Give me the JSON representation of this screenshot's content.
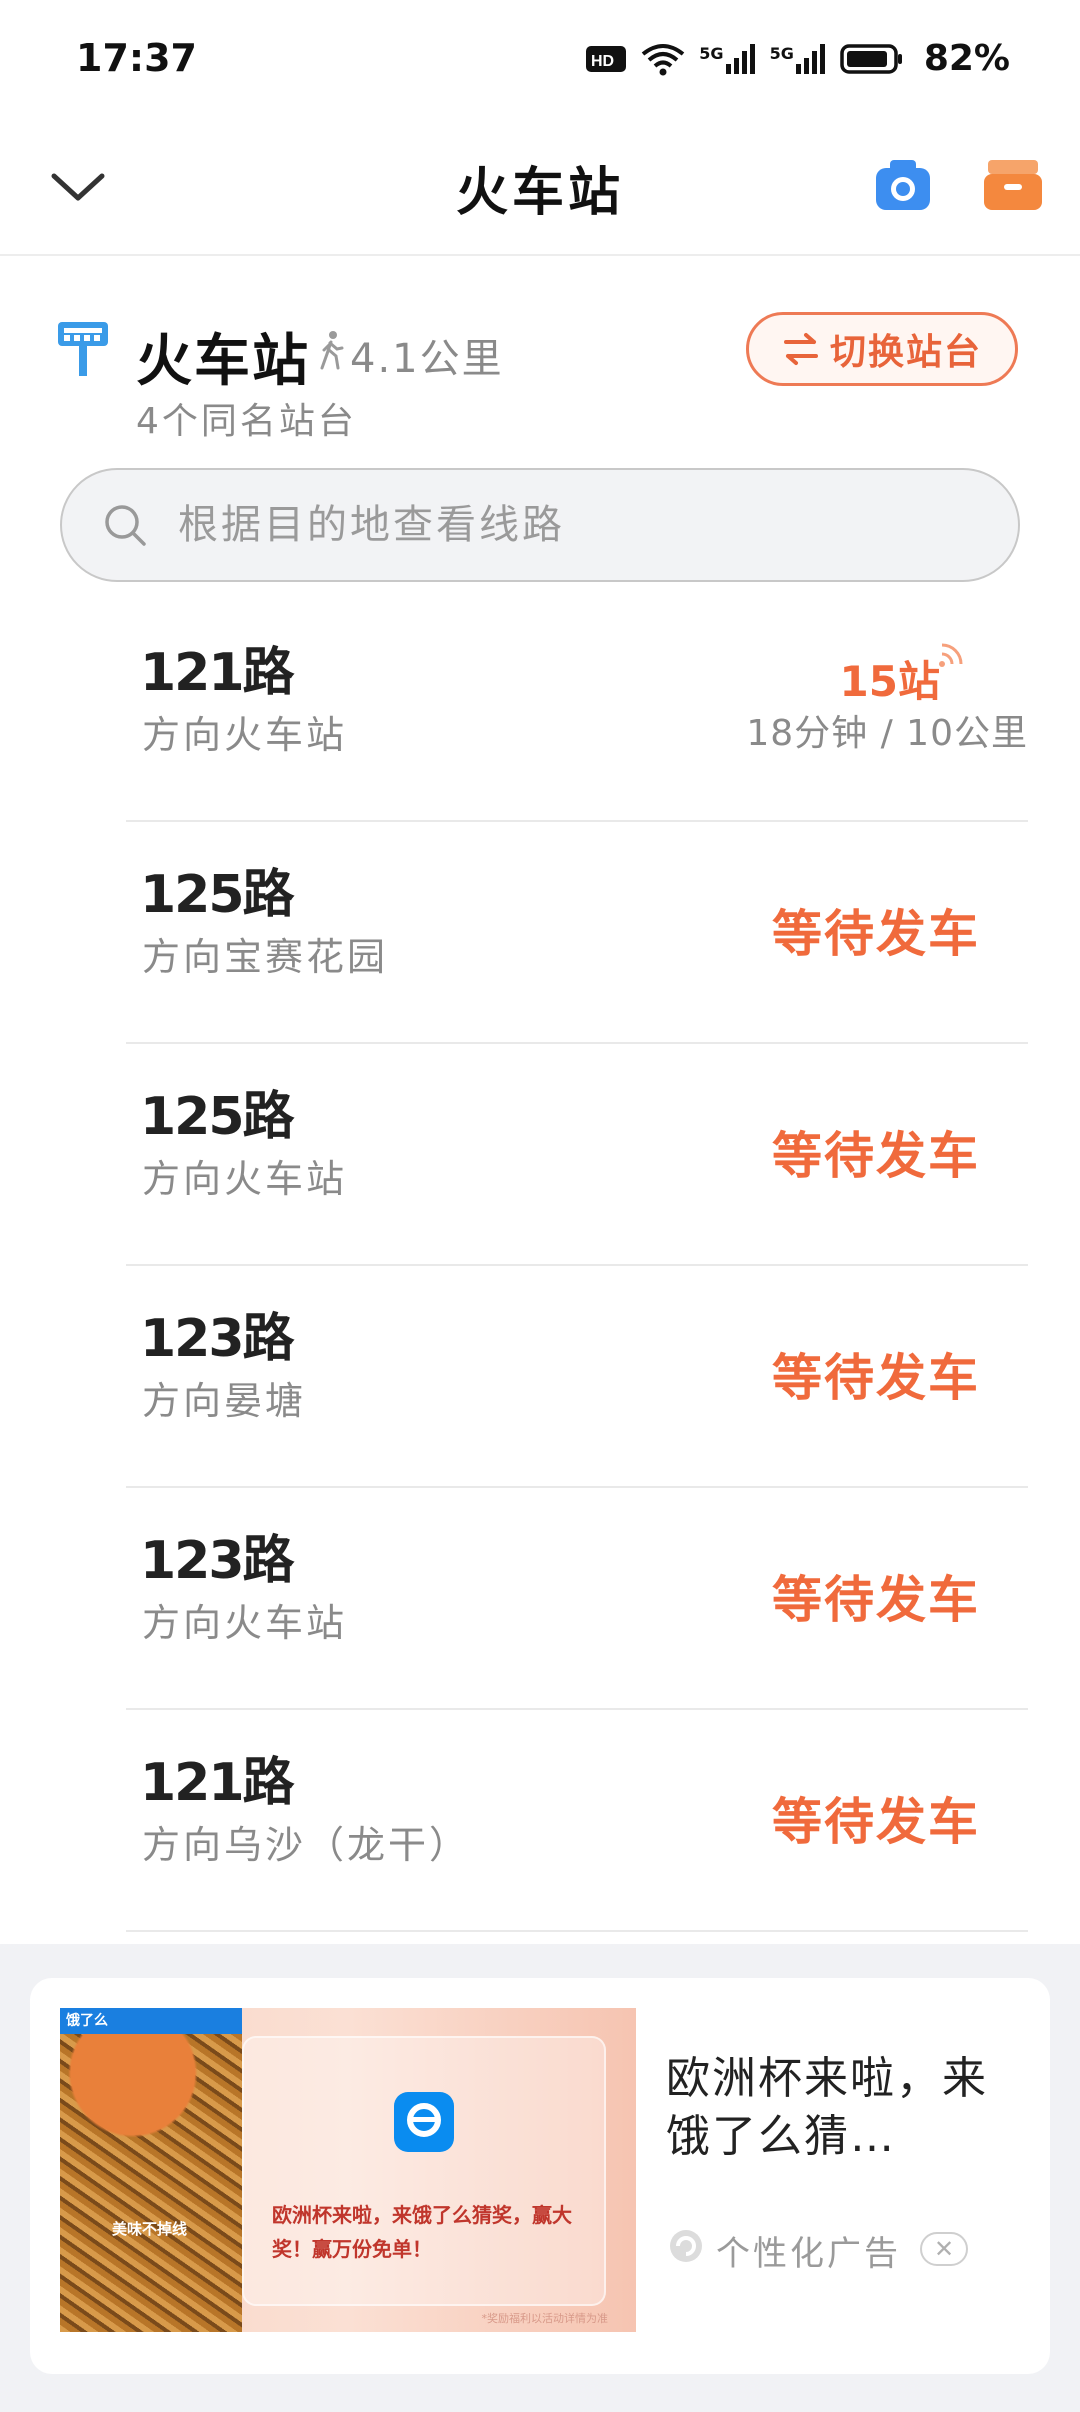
{
  "status_bar": {
    "time": "17:37",
    "network_1": "5G",
    "network_2": "5G",
    "battery": "82%"
  },
  "header": {
    "title": "火车站"
  },
  "station": {
    "name": "火车站",
    "distance": "4.1公里",
    "platforms": "4个同名站台",
    "switch_label": "切换站台"
  },
  "search": {
    "placeholder": "根据目的地查看线路"
  },
  "routes": [
    {
      "name": "121路",
      "direction": "方向火车站",
      "stops": "15站",
      "eta": "18分钟 / 10公里"
    },
    {
      "name": "125路",
      "direction": "方向宝赛花园",
      "status": "等待发车"
    },
    {
      "name": "125路",
      "direction": "方向火车站",
      "status": "等待发车"
    },
    {
      "name": "123路",
      "direction": "方向晏塘",
      "status": "等待发车"
    },
    {
      "name": "123路",
      "direction": "方向火车站",
      "status": "等待发车"
    },
    {
      "name": "121路",
      "direction": "方向乌沙（龙干）",
      "status": "等待发车"
    }
  ],
  "ad": {
    "title": "欧洲杯来啦，来饿了么猜…",
    "image_text": "欧洲杯来啦，来饿了么猜奖，赢大奖！赢万份免单！",
    "image_caption": "美味不掉线",
    "image_logo": "饿了么",
    "image_fineprint": "*奖励福利以活动详情为准",
    "label": "个性化广告",
    "close": "✕"
  },
  "colors": {
    "accent": "#f06a3c",
    "station_icon": "#3a9be8",
    "camera_icon": "#3d8ef0",
    "inbox_icon": "#f4883e"
  },
  "icons": {
    "back": "chevron-down-icon",
    "camera": "camera-icon",
    "inbox": "inbox-icon",
    "station": "bus-stop-icon",
    "walk": "walk-icon",
    "switch": "swap-icon",
    "search": "search-icon",
    "live": "realtime-signal-icon"
  }
}
